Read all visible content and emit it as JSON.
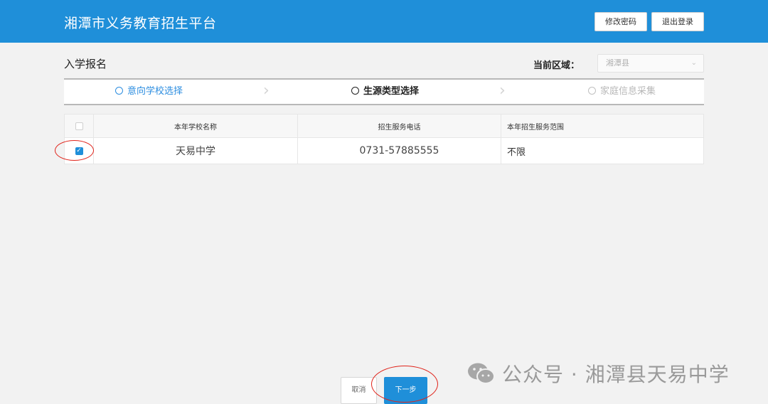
{
  "header": {
    "title": "湘潭市义务教育招生平台",
    "change_password": "修改密码",
    "logout": "退出登录"
  },
  "page": {
    "title": "入学报名",
    "region_label": "当前区域：",
    "region_value": "湘潭县"
  },
  "steps": [
    {
      "label": "意向学校选择",
      "state": "done"
    },
    {
      "label": "生源类型选择",
      "state": "active"
    },
    {
      "label": "家庭信息采集",
      "state": "pending"
    }
  ],
  "table": {
    "columns": [
      "本年学校名称",
      "招生服务电话",
      "本年招生服务范围"
    ],
    "rows": [
      {
        "checked": true,
        "school": "天易中学",
        "phone": "0731-57885555",
        "scope": "不限"
      }
    ]
  },
  "footer": {
    "cancel": "取消",
    "next": "下一步"
  },
  "watermark": {
    "text": "公众号 · 湘潭县天易中学"
  },
  "colors": {
    "brand": "#1f8fd9",
    "annotation": "#e0241b",
    "step_done": "#2d8ee0"
  },
  "icons": {
    "check": "checkmark-icon",
    "chevron": "chevron-down-icon",
    "step_sep": "chevron-right-icon",
    "watermark": "wechat-icon"
  }
}
